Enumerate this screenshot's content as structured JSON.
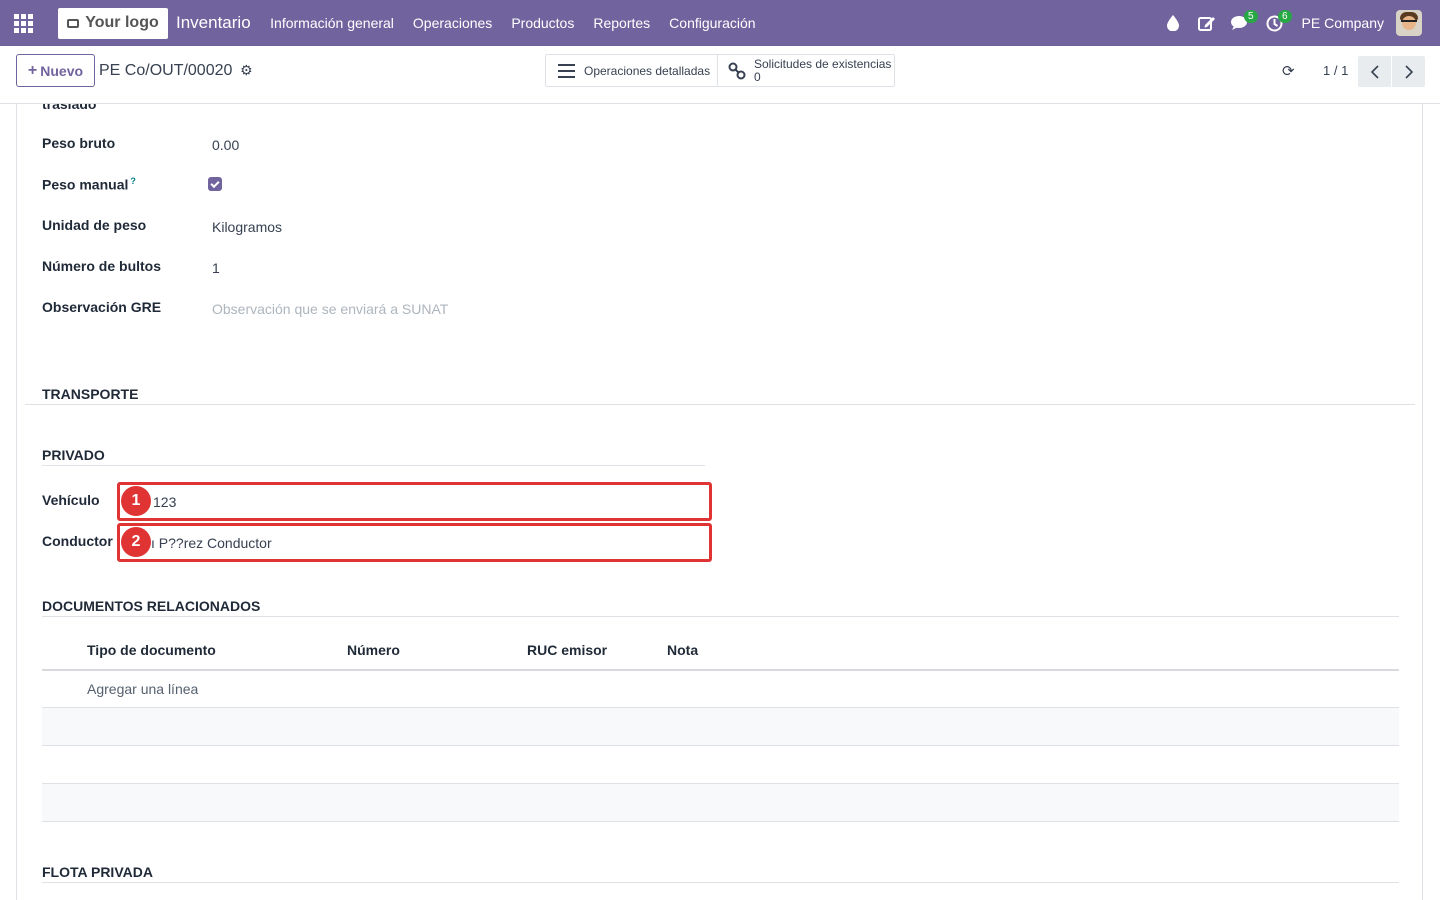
{
  "navbar": {
    "logo_text": "Your logo",
    "app_name": "Inventario",
    "menu": [
      "Información general",
      "Operaciones",
      "Productos",
      "Reportes",
      "Configuración"
    ],
    "messages_count": "5",
    "activities_count": "6",
    "company": "PE Company"
  },
  "control": {
    "new_label": "Nuevo",
    "record_name": "PE Co/OUT/00020",
    "smart_buttons": {
      "detailed_ops": "Operaciones detalladas",
      "stock_requests_label": "Solicitudes de existencias",
      "stock_requests_count": "0"
    },
    "pager": "1 / 1"
  },
  "form": {
    "cut_label": "traslado",
    "fields": {
      "gross_weight": {
        "label": "Peso bruto",
        "value": "0.00"
      },
      "manual_weight": {
        "label": "Peso manual",
        "help": "?",
        "checked": true
      },
      "weight_unit": {
        "label": "Unidad de peso",
        "value": "Kilogramos"
      },
      "packages": {
        "label": "Número de bultos",
        "value": "1"
      },
      "gre_note": {
        "label": "Observación GRE",
        "placeholder": "Observación que se enviará a SUNAT"
      }
    },
    "sections": {
      "transport": "TRANSPORTE",
      "private": "PRIVADO",
      "related_docs": "DOCUMENTOS RELACIONADOS",
      "private_fleet": "FLOTA PRIVADA"
    },
    "vehicle": {
      "label": "Vehículo",
      "value": "123",
      "marker": "1"
    },
    "driver": {
      "label": "Conductor",
      "value": "P??rez Conductor",
      "prefix": "ı",
      "marker": "2"
    },
    "table": {
      "headers": [
        "Tipo de documento",
        "Número",
        "RUC emisor",
        "Nota"
      ],
      "add_line": "Agregar una línea"
    }
  }
}
